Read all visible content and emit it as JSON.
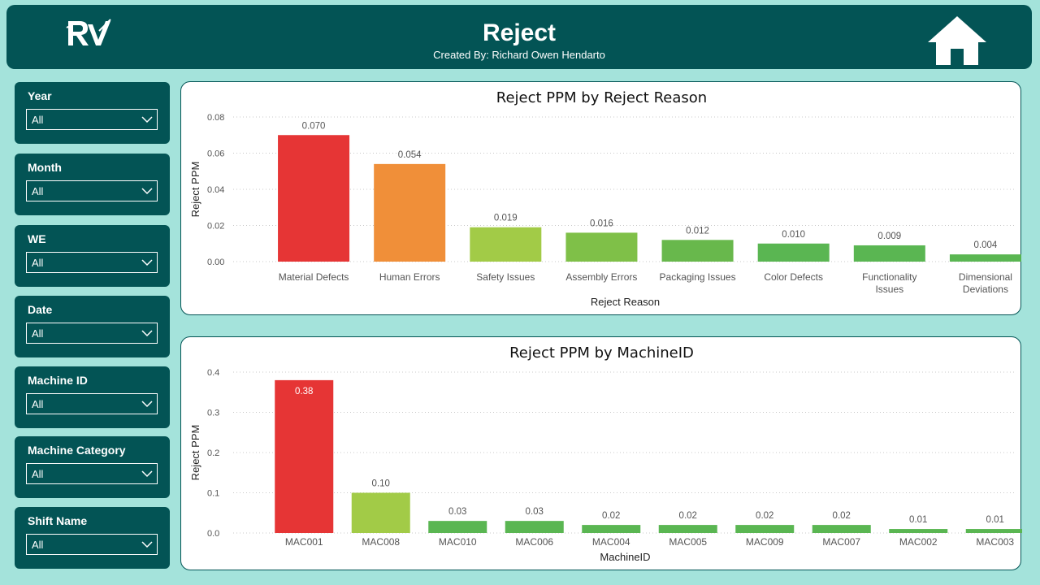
{
  "header": {
    "title": "Reject",
    "subtitle": "Created By: Richard Owen Hendarto",
    "logo_text": "RV"
  },
  "slicers": [
    {
      "label": "Year",
      "value": "All"
    },
    {
      "label": "Month",
      "value": "All"
    },
    {
      "label": "WE",
      "value": "All"
    },
    {
      "label": "Date",
      "value": "All"
    },
    {
      "label": "Machine ID",
      "value": "All"
    },
    {
      "label": "Machine Category",
      "value": "All"
    },
    {
      "label": "Shift Name",
      "value": "All"
    }
  ],
  "colors": {
    "teal_dark": "#035455",
    "background": "#a4e3db",
    "red": "#e63535",
    "orange": "#f08f39",
    "light_green": "#a2cb47",
    "green": "#5ab652"
  },
  "chart_data": [
    {
      "type": "bar",
      "title": "Reject PPM by Reject Reason",
      "xlabel": "Reject Reason",
      "ylabel": "Reject PPM",
      "categories": [
        "Material Defects",
        "Human Errors",
        "Safety Issues",
        "Assembly Errors",
        "Packaging Issues",
        "Color Defects",
        "Functionality Issues",
        "Dimensional Deviations"
      ],
      "values": [
        0.07,
        0.054,
        0.019,
        0.016,
        0.012,
        0.01,
        0.009,
        0.004
      ],
      "labels": [
        "0.070",
        "0.054",
        "0.019",
        "0.016",
        "0.012",
        "0.010",
        "0.009",
        "0.004"
      ],
      "bar_colors": [
        "#e63535",
        "#f08f39",
        "#a2cb47",
        "#7fc048",
        "#68b84c",
        "#5ab652",
        "#5ab652",
        "#5ab652"
      ],
      "ylim": [
        0,
        0.08
      ],
      "yticks": [
        "0.00",
        "0.02",
        "0.04",
        "0.06",
        "0.08"
      ],
      "ytick_values": [
        0,
        0.02,
        0.04,
        0.06,
        0.08
      ],
      "grid": true
    },
    {
      "type": "bar",
      "title": "Reject PPM by MachineID",
      "xlabel": "MachineID",
      "ylabel": "Reject PPM",
      "categories": [
        "MAC001",
        "MAC008",
        "MAC010",
        "MAC006",
        "MAC004",
        "MAC005",
        "MAC009",
        "MAC007",
        "MAC002",
        "MAC003"
      ],
      "values": [
        0.38,
        0.1,
        0.03,
        0.03,
        0.02,
        0.02,
        0.02,
        0.02,
        0.01,
        0.01
      ],
      "labels": [
        "0.38",
        "0.10",
        "0.03",
        "0.03",
        "0.02",
        "0.02",
        "0.02",
        "0.02",
        "0.01",
        "0.01"
      ],
      "bar_colors": [
        "#e63535",
        "#a2cb47",
        "#5ab652",
        "#5ab652",
        "#5ab652",
        "#5ab652",
        "#5ab652",
        "#5ab652",
        "#5ab652",
        "#5ab652"
      ],
      "ylim": [
        0,
        0.4
      ],
      "yticks": [
        "0.0",
        "0.1",
        "0.2",
        "0.3",
        "0.4"
      ],
      "ytick_values": [
        0,
        0.1,
        0.2,
        0.3,
        0.4
      ],
      "grid": true
    }
  ]
}
